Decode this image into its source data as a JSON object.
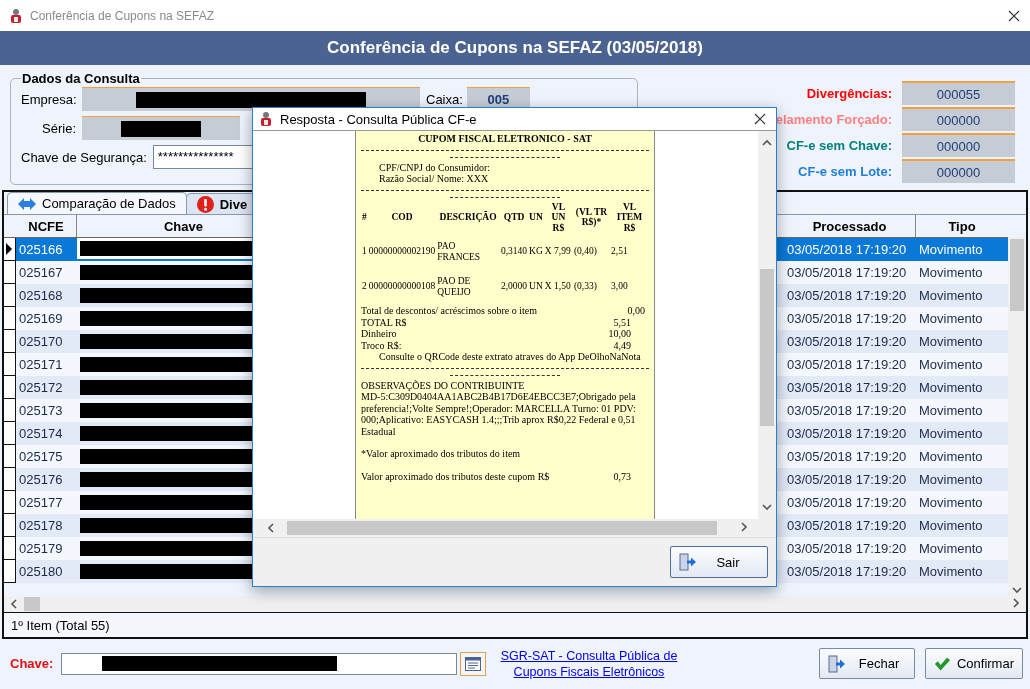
{
  "window": {
    "title": "Conferência de Cupons na SEFAZ"
  },
  "header": {
    "title": "Conferência de Cupons na SEFAZ (03/05/2018)"
  },
  "consulta": {
    "legend": "Dados da Consulta",
    "empresa": {
      "label": "Empresa:",
      "redacted": true
    },
    "caixa": {
      "label": "Caixa:",
      "value": "005"
    },
    "serie": {
      "label": "Série:",
      "redacted": true
    },
    "chave": {
      "label": "Chave de Segurança:",
      "value": "***************"
    }
  },
  "counters": [
    {
      "label": "Divergências:",
      "value": "000055",
      "color": "#ff0000"
    },
    {
      "label": "elamento Forçado:",
      "value": "000000",
      "color": "#ff7f7f"
    },
    {
      "label": "CF-e sem Chave:",
      "value": "000000",
      "color": "#008080"
    },
    {
      "label": "CF-e sem Lote:",
      "value": "000000",
      "color": "#1e7fd8"
    }
  ],
  "tabs": [
    {
      "label": "Comparação de Dados",
      "kind": "compare",
      "selected": true
    },
    {
      "label": "Dive",
      "kind": "alert",
      "selected": false
    }
  ],
  "grid": {
    "columns": [
      "NCFE",
      "Chave",
      "Processado",
      "Tipo"
    ],
    "rows": [
      {
        "ncfe": "025166",
        "chave_redacted": true,
        "processado": "03/05/2018 17:19:20",
        "tipo": "Movimento",
        "selected": true
      },
      {
        "ncfe": "025167",
        "chave_redacted": true,
        "processado": "03/05/2018 17:19:20",
        "tipo": "Movimento",
        "selected": false
      },
      {
        "ncfe": "025168",
        "chave_redacted": true,
        "processado": "03/05/2018 17:19:20",
        "tipo": "Movimento",
        "selected": false
      },
      {
        "ncfe": "025169",
        "chave_redacted": true,
        "processado": "03/05/2018 17:19:20",
        "tipo": "Movimento",
        "selected": false
      },
      {
        "ncfe": "025170",
        "chave_redacted": true,
        "processado": "03/05/2018 17:19:20",
        "tipo": "Movimento",
        "selected": false
      },
      {
        "ncfe": "025171",
        "chave_redacted": true,
        "processado": "03/05/2018 17:19:20",
        "tipo": "Movimento",
        "selected": false
      },
      {
        "ncfe": "025172",
        "chave_redacted": true,
        "processado": "03/05/2018 17:19:20",
        "tipo": "Movimento",
        "selected": false
      },
      {
        "ncfe": "025173",
        "chave_redacted": true,
        "processado": "03/05/2018 17:19:20",
        "tipo": "Movimento",
        "selected": false
      },
      {
        "ncfe": "025174",
        "chave_redacted": true,
        "processado": "03/05/2018 17:19:20",
        "tipo": "Movimento",
        "selected": false
      },
      {
        "ncfe": "025175",
        "chave_redacted": true,
        "processado": "03/05/2018 17:19:20",
        "tipo": "Movimento",
        "selected": false
      },
      {
        "ncfe": "025176",
        "chave_redacted": true,
        "processado": "03/05/2018 17:19:20",
        "tipo": "Movimento",
        "selected": false
      },
      {
        "ncfe": "025177",
        "chave_redacted": true,
        "processado": "03/05/2018 17:19:20",
        "tipo": "Movimento",
        "selected": false
      },
      {
        "ncfe": "025178",
        "chave_redacted": true,
        "processado": "03/05/2018 17:19:20",
        "tipo": "Movimento",
        "selected": false
      },
      {
        "ncfe": "025179",
        "chave_redacted": true,
        "processado": "03/05/2018 17:19:20",
        "tipo": "Movimento",
        "selected": false
      },
      {
        "ncfe": "025180",
        "chave_redacted": true,
        "processado": "03/05/2018 17:19:20",
        "tipo": "Movimento",
        "selected": false
      }
    ]
  },
  "status_bar": "1º Item (Total 55)",
  "bottom": {
    "chave_label": "Chave:",
    "chave_redacted": true,
    "link": "SGR-SAT - Consulta Pública de Cupons Fiscais Eletrônicos",
    "buttons": [
      {
        "label": "Fechar",
        "kind": "exit"
      },
      {
        "label": "Confirmar",
        "kind": "check"
      }
    ]
  },
  "dialog": {
    "title": "Resposta - Consulta Pública CF-e",
    "receipt": {
      "heading": "CUPOM FISCAL ELETRONICO - SAT",
      "consumer": [
        "CPF/CNPJ do Consumidor:",
        "Razão Social/ Nome: XXX"
      ],
      "item_columns": [
        "#",
        "COD",
        "DESCRIÇÃO",
        "QTD",
        "UN",
        "VL UN R$",
        "(VL TR R$)*",
        "VL ITEM R$"
      ],
      "items": [
        [
          "1",
          "00000000002190",
          "PAO FRANCES",
          "0,3140",
          "KG",
          "X 7,99",
          "(0,40)",
          "2,51"
        ],
        [
          "2",
          "00000000000108",
          "PAO DE QUEIJO",
          "2,0000",
          "UN",
          "X 1,50",
          "(0,33)",
          "3,00"
        ]
      ],
      "totals": [
        {
          "label": "Total de descontos/ acréscimos sobre o item",
          "value": "0,00"
        },
        {
          "label": "TOTAL R$",
          "value": "5,51"
        },
        {
          "label": "Dinheiro",
          "value": "10,00"
        },
        {
          "label": "Troco R$:",
          "value": "4,49"
        }
      ],
      "qr_note": "Consulte o QRCode deste extrato atraves do App DeOlhoNaNota",
      "obs_title": "OBSERVAÇÕES DO CONTRIBUINTE",
      "obs_text": "MD-5:C309D0404AA1ABC2B4B17D6E4EBCC3E7;Obrigado pela preferencia!;Volte Sempre!;Operador: MARCELLA Turno: 01 PDV: 000;Aplicativo: EASYCASH 1.4;;;Trib aprox R$0,22 Federal e 0,51 Estadual",
      "item_note": "*Valor aproximado dos tributos do item",
      "tax": {
        "label": "Valor aproximado dos tributos deste cupom R$",
        "value": "0,73"
      }
    },
    "button": {
      "label": "Sair",
      "kind": "exit"
    }
  }
}
